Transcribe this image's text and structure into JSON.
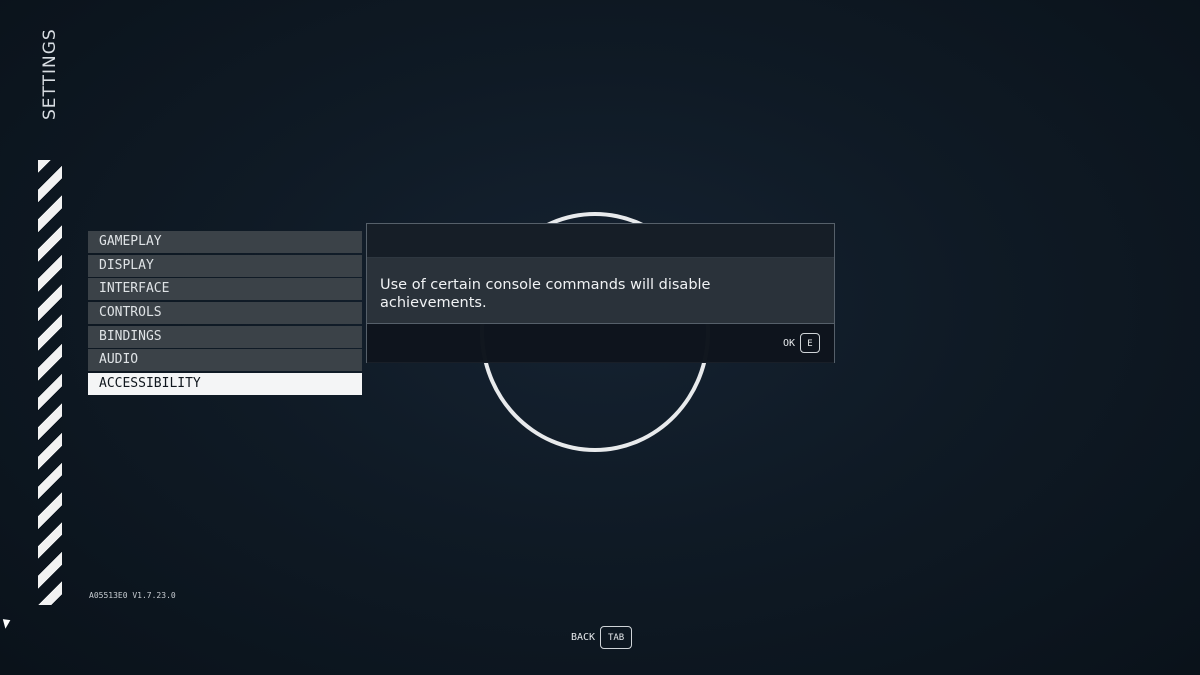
{
  "title": "SETTINGS",
  "menu": {
    "items": [
      {
        "label": "GAMEPLAY",
        "selected": false
      },
      {
        "label": "DISPLAY",
        "selected": false
      },
      {
        "label": "INTERFACE",
        "selected": false
      },
      {
        "label": "CONTROLS",
        "selected": false
      },
      {
        "label": "BINDINGS",
        "selected": false
      },
      {
        "label": "AUDIO",
        "selected": false
      },
      {
        "label": "ACCESSIBILITY",
        "selected": true
      }
    ]
  },
  "dialog": {
    "message": "Use of certain console commands will disable achievements.",
    "ok_label": "OK",
    "ok_key": "E"
  },
  "version": "A05513E0 V1.7.23.0",
  "footer": {
    "back_label": "BACK",
    "back_key": "TAB"
  }
}
